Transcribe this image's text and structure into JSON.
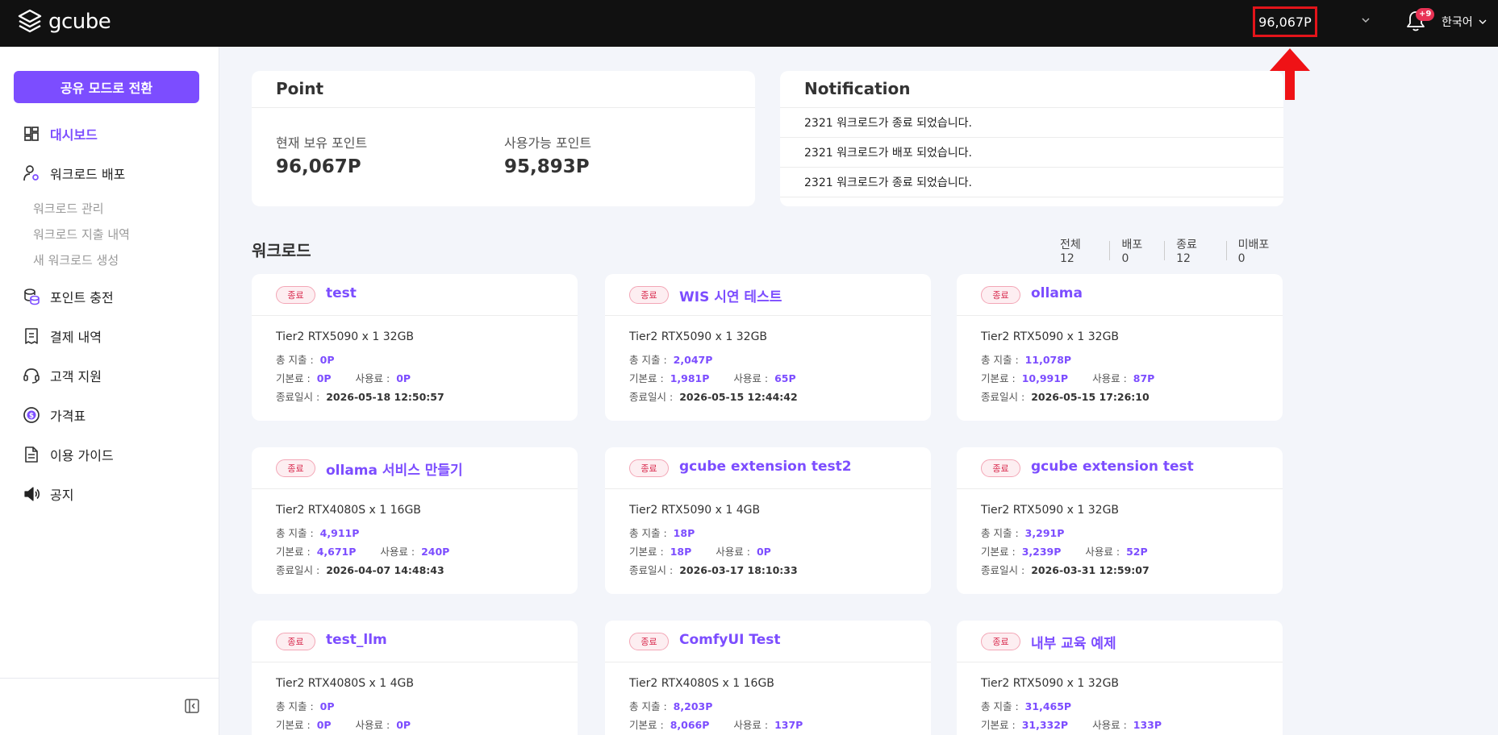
{
  "header": {
    "logo_text": "gcube",
    "points_display": "96,067P",
    "notification_badge": "+9",
    "language": "한국어"
  },
  "sidebar": {
    "share_button": "공유 모드로 전환",
    "items": [
      {
        "label": "대시보드",
        "icon": "dashboard-icon",
        "active": true
      },
      {
        "label": "워크로드 배포",
        "icon": "user-gear-icon"
      },
      {
        "label": "포인트 충전",
        "icon": "coins-icon"
      },
      {
        "label": "결제 내역",
        "icon": "receipt-icon"
      },
      {
        "label": "고객 지원",
        "icon": "headset-icon"
      },
      {
        "label": "가격표",
        "icon": "dollar-icon"
      },
      {
        "label": "이용 가이드",
        "icon": "document-icon"
      },
      {
        "label": "공지",
        "icon": "megaphone-icon"
      }
    ],
    "subitems": [
      "워크로드 관리",
      "워크로드 지출 내역",
      "새 워크로드 생성"
    ]
  },
  "point_card": {
    "title": "Point",
    "current_label": "현재 보유 포인트",
    "current_value": "96,067P",
    "available_label": "사용가능 포인트",
    "available_value": "95,893P"
  },
  "notification_card": {
    "title": "Notification",
    "items": [
      "2321 워크로드가 종료 되었습니다.",
      "2321 워크로드가 배포 되었습니다.",
      "2321 워크로드가 종료 되었습니다."
    ]
  },
  "workloads": {
    "title": "워크로드",
    "filters": [
      "전체 12",
      "배포 0",
      "종료 12",
      "미배포 0"
    ],
    "labels": {
      "total": "총 지출 :",
      "base": "기본료 :",
      "usage": "사용료 :",
      "ended": "종료일시 :"
    },
    "cards": [
      {
        "status": "종료",
        "name": "test",
        "gpu": "Tier2 RTX5090 x 1 32GB",
        "total": "0P",
        "base": "0P",
        "usage": "0P",
        "ended": "2026-05-18 12:50:57"
      },
      {
        "status": "종료",
        "name": "WIS 시연 테스트",
        "gpu": "Tier2 RTX5090 x 1 32GB",
        "total": "2,047P",
        "base": "1,981P",
        "usage": "65P",
        "ended": "2026-05-15 12:44:42"
      },
      {
        "status": "종료",
        "name": "ollama",
        "gpu": "Tier2 RTX5090 x 1 32GB",
        "total": "11,078P",
        "base": "10,991P",
        "usage": "87P",
        "ended": "2026-05-15 17:26:10"
      },
      {
        "status": "종료",
        "name": "ollama 서비스 만들기",
        "gpu": "Tier2 RTX4080S x 1 16GB",
        "total": "4,911P",
        "base": "4,671P",
        "usage": "240P",
        "ended": "2026-04-07 14:48:43"
      },
      {
        "status": "종료",
        "name": "gcube extension test2",
        "gpu": "Tier2 RTX5090 x 1 4GB",
        "total": "18P",
        "base": "18P",
        "usage": "0P",
        "ended": "2026-03-17 18:10:33"
      },
      {
        "status": "종료",
        "name": "gcube extension test",
        "gpu": "Tier2 RTX5090 x 1 32GB",
        "total": "3,291P",
        "base": "3,239P",
        "usage": "52P",
        "ended": "2026-03-31 12:59:07"
      },
      {
        "status": "종료",
        "name": "test_llm",
        "gpu": "Tier2 RTX4080S x 1 4GB",
        "total": "0P",
        "base": "0P",
        "usage": "0P"
      },
      {
        "status": "종료",
        "name": "ComfyUI Test",
        "gpu": "Tier2 RTX4080S x 1 16GB",
        "total": "8,203P",
        "base": "8,066P",
        "usage": "137P"
      },
      {
        "status": "종료",
        "name": "내부 교육 예제",
        "gpu": "Tier2 RTX5090 x 1 32GB",
        "total": "31,465P",
        "base": "31,332P",
        "usage": "133P"
      }
    ]
  },
  "colors": {
    "accent": "#7c4dff",
    "topbar": "#111111",
    "highlight": "#e3141a",
    "status_badge": "#d8284c"
  }
}
